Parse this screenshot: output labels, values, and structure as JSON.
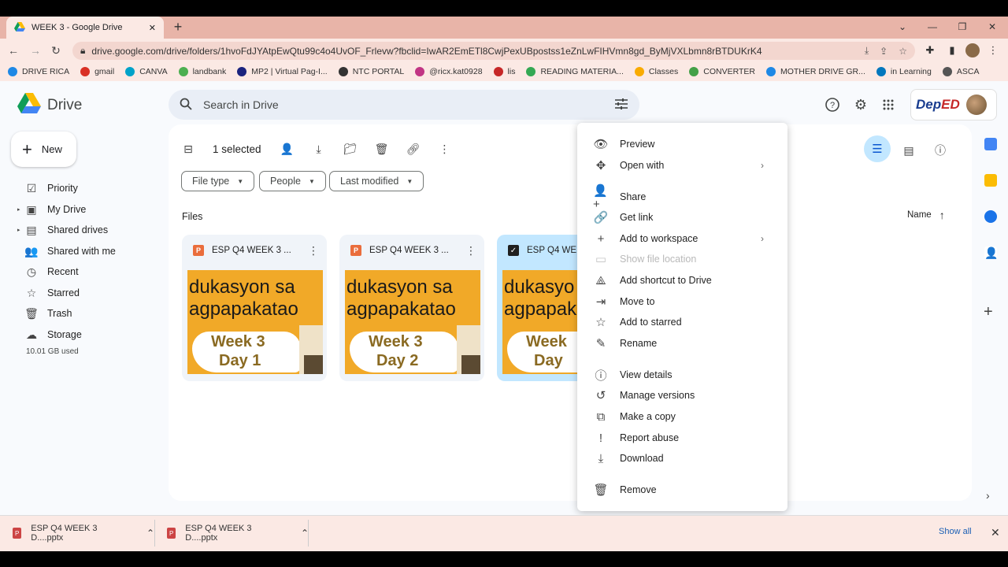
{
  "browser": {
    "tab_title": "WEEK 3 - Google Drive",
    "tab_close": "✕",
    "new_tab": "+",
    "window_controls": {
      "minimize": "—",
      "maximize": "❐",
      "close": "✕",
      "tab_search": "⌄"
    },
    "url": "drive.google.com/drive/folders/1hvoFdJYAtpEwQtu99c4o4UvOF_Frlevw?fbclid=IwAR2EmETl8CwjPexUBpostss1eZnLwFIHVmn8gd_ByMjVXLbmn8rBTDUKrK4",
    "bookmarks": [
      {
        "label": "DRIVE RICA",
        "color": "#1e88e5"
      },
      {
        "label": "gmail",
        "color": "#d93025"
      },
      {
        "label": "CANVA",
        "color": "#00a2c9"
      },
      {
        "label": "landbank",
        "color": "#4caf50"
      },
      {
        "label": "MP2 | Virtual Pag-I...",
        "color": "#1a237e"
      },
      {
        "label": "NTC PORTAL",
        "color": "#333333"
      },
      {
        "label": "@ricx.kat0928",
        "color": "#c13584"
      },
      {
        "label": "lis",
        "color": "#c62828"
      },
      {
        "label": "READING MATERIA...",
        "color": "#34a853"
      },
      {
        "label": "Classes",
        "color": "#f9ab00"
      },
      {
        "label": "CONVERTER",
        "color": "#43a047"
      },
      {
        "label": "MOTHER DRIVE GR...",
        "color": "#1e88e5"
      },
      {
        "label": "in Learning",
        "color": "#0277bd"
      },
      {
        "label": "ASCA",
        "color": "#555555"
      }
    ]
  },
  "drive": {
    "app_name": "Drive",
    "search_placeholder": "Search in Drive",
    "new_button": "New",
    "deped_logo": {
      "left": "Dep",
      "right": "ED"
    },
    "nav": [
      {
        "label": "Priority",
        "icon": "☑",
        "caret": ""
      },
      {
        "label": "My Drive",
        "icon": "▣",
        "caret": "▸"
      },
      {
        "label": "Shared drives",
        "icon": "▤",
        "caret": "▸"
      },
      {
        "label": "Shared with me",
        "icon": "👥",
        "caret": ""
      },
      {
        "label": "Recent",
        "icon": "◷",
        "caret": ""
      },
      {
        "label": "Starred",
        "icon": "☆",
        "caret": ""
      },
      {
        "label": "Trash",
        "icon": "🗑",
        "caret": ""
      },
      {
        "label": "Storage",
        "icon": "☁",
        "caret": ""
      }
    ],
    "storage_used": "10.01 GB used",
    "selection": "1 selected",
    "filters": [
      "File type",
      "People",
      "Last modified"
    ],
    "files_label": "Files",
    "sort_label": "Name",
    "files": [
      {
        "name": "ESP Q4 WEEK 3 ...",
        "line1": "dukasyon sa",
        "line2": "agpapakatao",
        "week": "Week 3",
        "day": "Day 1",
        "selected": false
      },
      {
        "name": "ESP Q4 WEEK 3 ...",
        "line1": "dukasyon sa",
        "line2": "agpapakatao",
        "week": "Week 3",
        "day": "Day 2",
        "selected": false
      },
      {
        "name": "ESP Q4 WE",
        "line1": "dukasyo",
        "line2": "agpapak",
        "week": "Week",
        "day": "Day",
        "selected": true
      }
    ]
  },
  "context_menu": [
    {
      "label": "Preview",
      "icon": "👁",
      "submenu": false,
      "disabled": false
    },
    {
      "label": "Open with",
      "icon": "✥",
      "submenu": true,
      "disabled": false
    },
    {
      "label": "Share",
      "icon": "👤+",
      "submenu": false,
      "disabled": false
    },
    {
      "label": "Get link",
      "icon": "🔗",
      "submenu": false,
      "disabled": false
    },
    {
      "label": "Add to workspace",
      "icon": "+",
      "submenu": true,
      "disabled": false
    },
    {
      "label": "Show file location",
      "icon": "▭",
      "submenu": false,
      "disabled": true
    },
    {
      "label": "Add shortcut to Drive",
      "icon": "⟁",
      "submenu": false,
      "disabled": false
    },
    {
      "label": "Move to",
      "icon": "⇥",
      "submenu": false,
      "disabled": false
    },
    {
      "label": "Add to starred",
      "icon": "☆",
      "submenu": false,
      "disabled": false
    },
    {
      "label": "Rename",
      "icon": "✎",
      "submenu": false,
      "disabled": false
    },
    {
      "label": "View details",
      "icon": "ⓘ",
      "submenu": false,
      "disabled": false
    },
    {
      "label": "Manage versions",
      "icon": "↺",
      "submenu": false,
      "disabled": false
    },
    {
      "label": "Make a copy",
      "icon": "⧉",
      "submenu": false,
      "disabled": false
    },
    {
      "label": "Report abuse",
      "icon": "!",
      "submenu": false,
      "disabled": false
    },
    {
      "label": "Download",
      "icon": "⤓",
      "submenu": false,
      "disabled": false
    },
    {
      "label": "Remove",
      "icon": "🗑",
      "submenu": false,
      "disabled": false
    }
  ],
  "downloads": {
    "items": [
      "ESP Q4 WEEK 3 D....pptx",
      "ESP Q4 WEEK 3 D....pptx"
    ],
    "show_all": "Show all"
  },
  "colors": {
    "selected_card": "#c2e7ff",
    "accent": "#0b57d0",
    "thumb_bg": "#f1a928"
  }
}
